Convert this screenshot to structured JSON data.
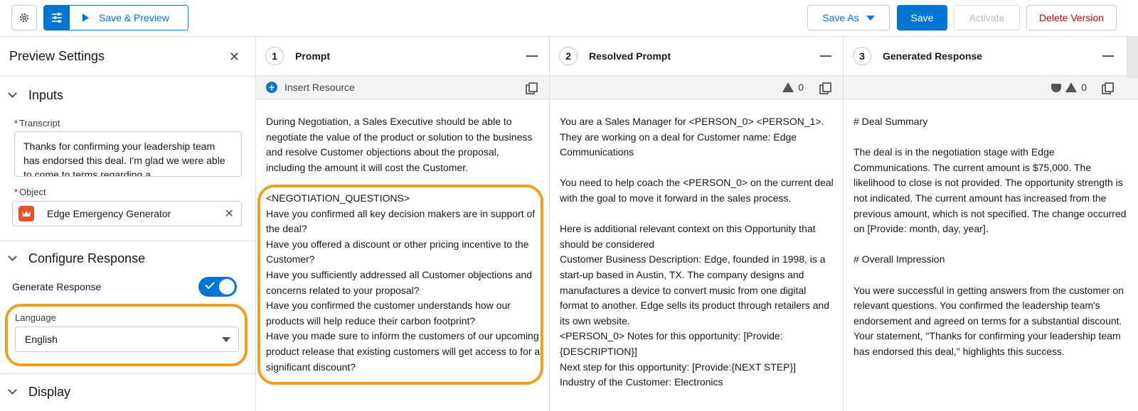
{
  "toolbar": {
    "save_preview": "Save & Preview",
    "save_as": "Save As",
    "save": "Save",
    "activate": "Activate",
    "delete_version": "Delete Version"
  },
  "preview_settings": {
    "title": "Preview Settings",
    "inputs_section": "Inputs",
    "transcript_label": "Transcript",
    "transcript_value": "Thanks for confirming your leadership team has endorsed this deal. I'm glad we were able to come to terms regarding a",
    "object_label": "Object",
    "object_value": "Edge Emergency Generator",
    "configure_section": "Configure Response",
    "generate_response_label": "Generate Response",
    "generate_response_enabled": true,
    "language_label": "Language",
    "language_value": "English",
    "display_section": "Display"
  },
  "columns": [
    {
      "number": "1",
      "title": "Prompt",
      "toolbar_label": "Insert Resource",
      "body_intro": "During Negotiation, a Sales Executive should be able to negotiate the value of the product or solution to the business and resolve Customer objections about the proposal, including the amount it will cost the Customer.",
      "body_questions": "<NEGOTIATION_QUESTIONS>\nHave you confirmed all key decision makers are in support of the deal?\nHave you offered a discount or other pricing incentive to the Customer?\nHave you sufficiently addressed all Customer objections and concerns related to your proposal?\nHave you confirmed the customer understands how our products will help reduce their carbon footprint?\nHave you made sure to inform the customers of our upcoming product release that existing customers will get access to for a significant discount?"
    },
    {
      "number": "2",
      "title": "Resolved Prompt",
      "warning_count": "0",
      "body": "You are a Sales Manager for <PERSON_0> <PERSON_1>. They are working on a deal for Customer name: Edge Communications\n\nYou need to help coach the <PERSON_0> on the current deal with the goal to move it forward in the sales process.\n\nHere is additional relevant context on this Opportunity that should be considered\nCustomer Business Description: Edge, founded in 1998, is a start-up based in Austin, TX. The company designs and manufactures a device to convert music from one digital format to another. Edge sells its product through retailers and its own website.\n<PERSON_0> Notes for this opportunity: [Provide: {DESCRIPTION}]\nNext step for this opportunity: [Provide:{NEXT STEP}]\nIndustry of the Customer: Electronics"
    },
    {
      "number": "3",
      "title": "Generated Response",
      "warning_count": "0",
      "body": "# Deal Summary\n\nThe deal is in the negotiation stage with Edge Communications. The current amount is $75,000. The likelihood to close is not provided. The opportunity strength is not indicated. The current amount has increased from the previous amount, which is not specified. The change occurred on [Provide: month, day, year].\n\n# Overall Impression\n\nYou were successful in getting answers from the customer on relevant questions. You confirmed the leadership team's endorsement and agreed on terms for a substantial discount. Your statement, \"Thanks for confirming your leadership team has endorsed this deal,\" highlights this success."
    }
  ],
  "colors": {
    "brand": "#0176d3",
    "highlight": "#f0a020",
    "destructive": "#ba0517"
  }
}
